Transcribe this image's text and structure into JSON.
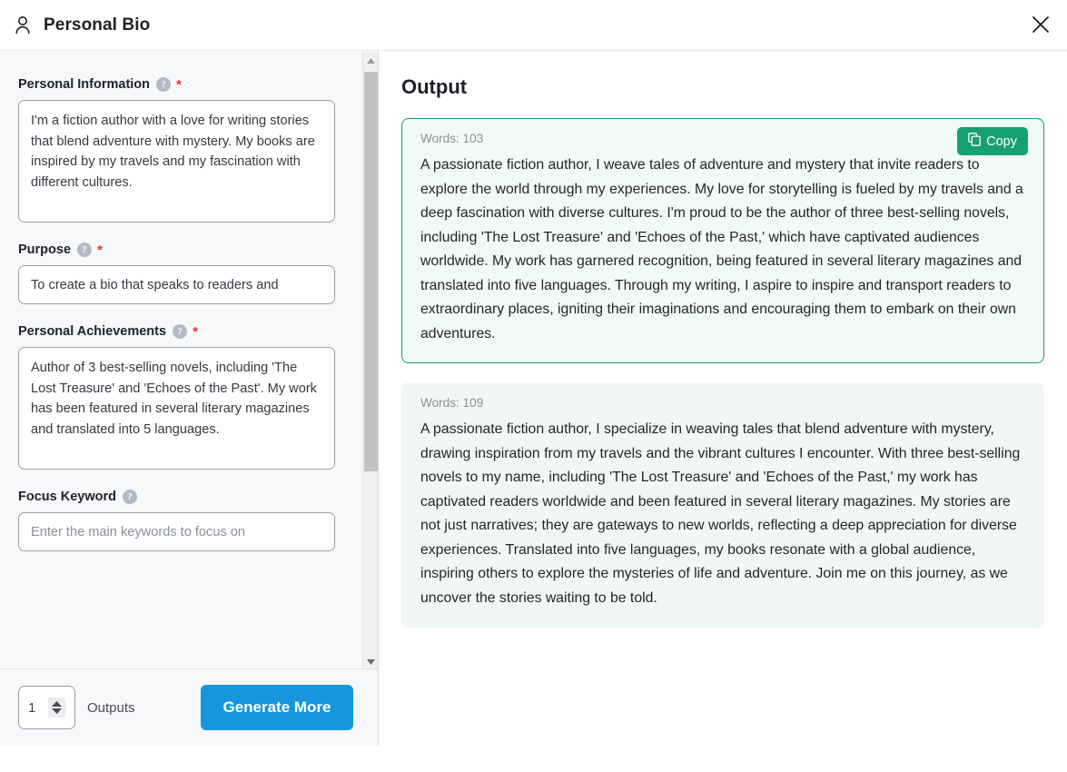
{
  "header": {
    "title": "Personal Bio",
    "person_icon": "person-icon",
    "close_icon": "close-icon"
  },
  "form": {
    "fields": [
      {
        "label": "Personal Information",
        "help_icon": "help-icon",
        "required_marker": "*",
        "value": "I'm a fiction author with a love for writing stories that blend adventure with mystery. My books are inspired by my travels and my fascination with different cultures.",
        "placeholder": ""
      },
      {
        "label": "Purpose",
        "help_icon": "help-icon",
        "required_marker": "*",
        "value": "To create a bio that speaks to readers and",
        "placeholder": ""
      },
      {
        "label": "Personal Achievements",
        "help_icon": "help-icon",
        "required_marker": "*",
        "value": "Author of 3 best-selling novels, including 'The Lost Treasure' and 'Echoes of the Past'. My work has been featured in several literary magazines and translated into 5 languages.",
        "placeholder": ""
      },
      {
        "label": "Focus Keyword",
        "help_icon": "help-icon",
        "required_marker": "",
        "value": "",
        "placeholder": "Enter the main keywords to focus on"
      }
    ],
    "help_glyph": "?"
  },
  "scrollbar": {
    "up_arrow_icon": "caret-up-icon",
    "down_arrow_icon": "caret-down-icon"
  },
  "footer": {
    "outputs_count": "1",
    "outputs_label": "Outputs",
    "generate_label": "Generate More",
    "stepper_up_icon": "caret-up-icon",
    "stepper_down_icon": "caret-down-icon"
  },
  "output": {
    "title": "Output",
    "copy_label": "Copy",
    "copy_icon": "copy-icon",
    "cards": [
      {
        "words_label": "Words: 103",
        "text": "A passionate fiction author, I weave tales of adventure and mystery that invite readers to explore the world through my experiences. My love for storytelling is fueled by my travels and a deep fascination with diverse cultures. I'm proud to be the author of three best-selling novels, including 'The Lost Treasure' and 'Echoes of the Past,' which have captivated audiences worldwide. My work has garnered recognition, being featured in several literary magazines and translated into five languages. Through my writing, I aspire to inspire and transport readers to extraordinary places, igniting their imaginations and encouraging them to embark on their own adventures."
      },
      {
        "words_label": "Words: 109",
        "text": "A passionate fiction author, I specialize in weaving tales that blend adventure with mystery, drawing inspiration from my travels and the vibrant cultures I encounter. With three best-selling novels to my name, including 'The Lost Treasure' and 'Echoes of the Past,' my work has captivated readers worldwide and been featured in several literary magazines. My stories are not just narratives; they are gateways to new worlds, reflecting a deep appreciation for diverse experiences. Translated into five languages, my books resonate with a global audience, inspiring others to explore the mysteries of life and adventure. Join me on this journey, as we uncover the stories waiting to be told."
      }
    ]
  },
  "colors": {
    "accent_blue": "#1596dd",
    "accent_green": "#17a074",
    "card_active_bg": "#f0faf6",
    "card_plain_bg": "#f1f7f5",
    "panel_bg": "#f7f8fa",
    "required_red": "#f02e2e"
  }
}
